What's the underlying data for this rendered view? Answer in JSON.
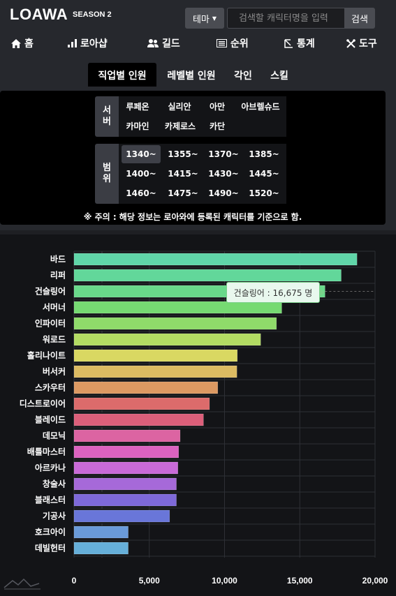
{
  "header": {
    "logo": "LOAWA",
    "season": "SEASON 2",
    "theme_label": "테마",
    "search_placeholder": "검색할 캐릭터명을 입력",
    "search_button": "검색"
  },
  "nav": {
    "items": [
      {
        "label": "홈",
        "icon": "home-icon"
      },
      {
        "label": "로아샵",
        "icon": "bar-chart-icon"
      },
      {
        "label": "길드",
        "icon": "users-icon"
      },
      {
        "label": "순위",
        "icon": "list-icon"
      },
      {
        "label": "통계",
        "icon": "statistics-icon"
      },
      {
        "label": "도구",
        "icon": "tools-icon"
      }
    ]
  },
  "subtabs": [
    {
      "label": "직업별 인원",
      "active": true
    },
    {
      "label": "레벨별 인원",
      "active": false
    },
    {
      "label": "각인",
      "active": false
    },
    {
      "label": "스킬",
      "active": false
    }
  ],
  "filters": {
    "server_label": "서버",
    "servers": [
      "루페온",
      "실리안",
      "아만",
      "아브렐슈드",
      "카마인",
      "카제로스",
      "카단"
    ],
    "range_label": "범위",
    "ranges": [
      "1340~",
      "1355~",
      "1370~",
      "1385~",
      "1400~",
      "1415~",
      "1430~",
      "1445~",
      "1460~",
      "1475~",
      "1490~",
      "1520~"
    ],
    "active_range": "1340~",
    "notice": "※ 주의 : 해당 정보는 로아와에 등록된 캐릭터를 기준으로 함."
  },
  "tooltip": {
    "text": "건슬링어 : 16,675 명",
    "category": "건슬링어"
  },
  "chart_data": {
    "type": "bar",
    "orientation": "horizontal",
    "categories": [
      "바드",
      "리퍼",
      "건슬링어",
      "서머너",
      "인파이터",
      "워로드",
      "홀리나이트",
      "버서커",
      "스카우터",
      "디스트로이어",
      "블레이드",
      "데모닉",
      "배틀마스터",
      "아르카나",
      "창술사",
      "블래스터",
      "기공사",
      "호크아이",
      "데빌헌터"
    ],
    "values": [
      18800,
      17750,
      16675,
      13800,
      13450,
      12400,
      10850,
      10820,
      9550,
      9000,
      8600,
      7050,
      6950,
      6900,
      6800,
      6800,
      6350,
      3600,
      3600
    ],
    "colors": [
      "#60d6a9",
      "#62d79a",
      "#69d98a",
      "#76da72",
      "#8fdb6a",
      "#b3dc63",
      "#d9d862",
      "#dcbb62",
      "#dc9962",
      "#dc6b6b",
      "#dc5f7a",
      "#dc64a2",
      "#dc62c0",
      "#c96ad8",
      "#a669d9",
      "#7e69d9",
      "#6976d9",
      "#6a9ad9",
      "#66afd9"
    ],
    "x_ticks": [
      "0",
      "5,000",
      "10,000",
      "15,000",
      "20,000"
    ],
    "xlim": [
      0,
      20000
    ],
    "grid": true,
    "legend": "none"
  }
}
